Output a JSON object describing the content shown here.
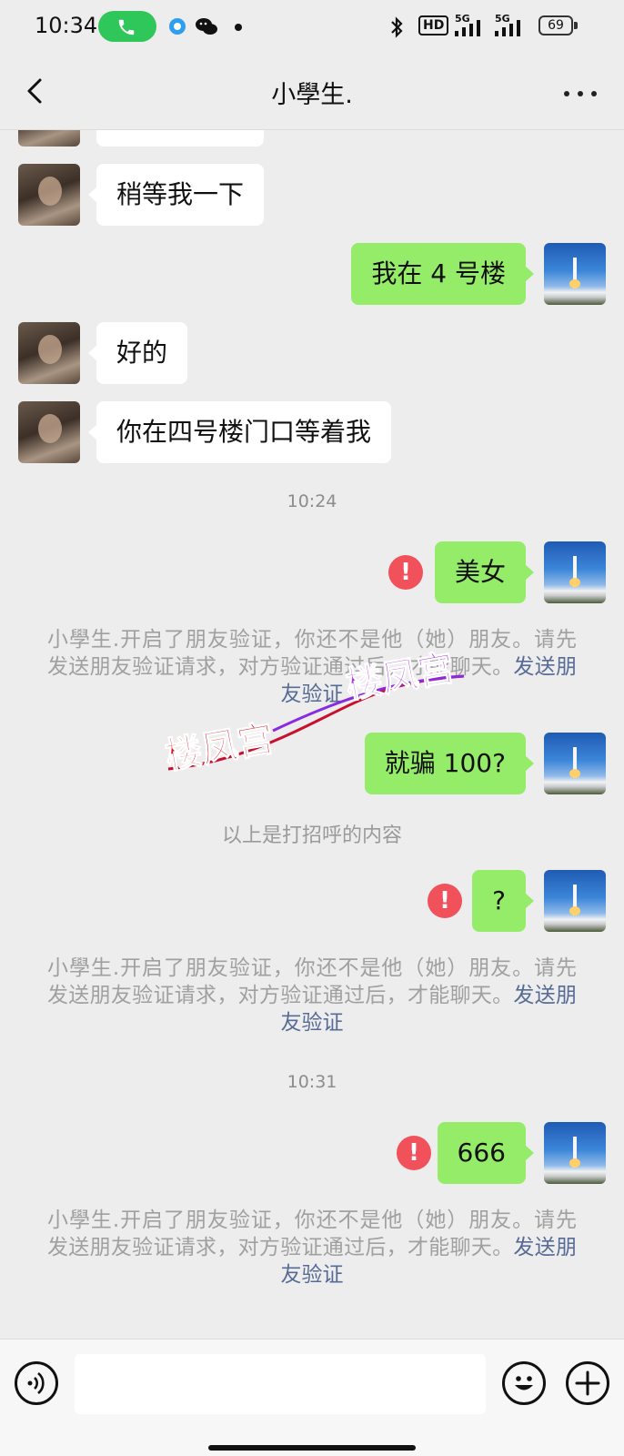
{
  "status_bar": {
    "time": "10:34",
    "battery": "69",
    "hd_label": "HD",
    "signal_label_1": "5G",
    "signal_label_2": "5G"
  },
  "header": {
    "title": "小學生."
  },
  "messages": [
    {
      "side": "in",
      "text": "稍等我一下"
    },
    {
      "side": "out",
      "text": "我在 4 号楼"
    },
    {
      "side": "in",
      "text": "好的"
    },
    {
      "side": "in",
      "text": "你在四号楼门口等着我"
    },
    {
      "side": "out",
      "text": "美女",
      "failed": true
    },
    {
      "side": "out",
      "text": "就骗 100?"
    },
    {
      "side": "out",
      "text": "?",
      "failed": true
    },
    {
      "side": "out",
      "text": "666",
      "failed": true
    }
  ],
  "timestamps": [
    "10:24",
    "10:31"
  ],
  "system_notice": {
    "text": "小學生.开启了朋友验证，你还不是他（她）朋友。请先发送朋友验证请求，对方验证通过后，才能聊天。",
    "link": "发送朋友验证"
  },
  "greeting_note": "以上是打招呼的内容",
  "error_mark": "!",
  "watermark": "楼凤宫",
  "colors": {
    "sent_bubble": "#95ec69",
    "received_bubble": "#ffffff",
    "error": "#f0515a",
    "link": "#576b95",
    "background": "#ededed"
  }
}
